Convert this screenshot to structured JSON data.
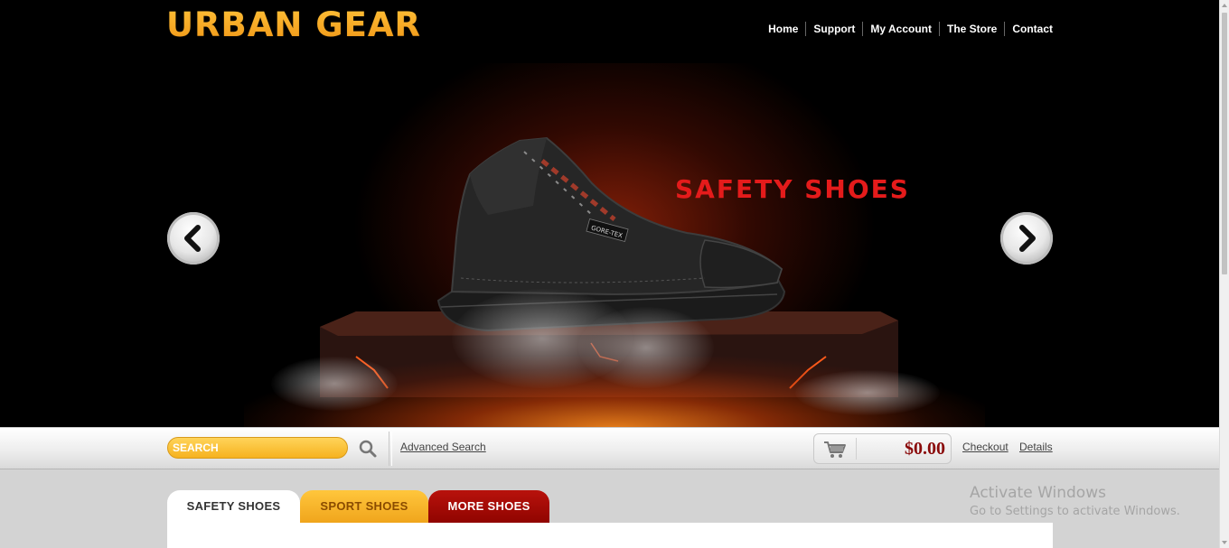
{
  "brand": {
    "logo_text": "URBAN GEAR"
  },
  "nav": {
    "items": [
      "Home",
      "Support",
      "My Account",
      "The Store",
      "Contact"
    ]
  },
  "hero": {
    "title": "SAFETY SHOES",
    "shoe_label": "GORE-TEX",
    "prev_icon": "chevron-left-icon",
    "next_icon": "chevron-right-icon"
  },
  "toolbar": {
    "search_placeholder": "SEARCH",
    "search_icon": "search-icon",
    "advanced_search": "Advanced Search",
    "cart_icon": "cart-icon",
    "cart_total": "$0.00",
    "checkout": "Checkout",
    "details": "Details"
  },
  "tabs": [
    "SAFETY SHOES",
    "SPORT SHOES",
    "MORE SHOES"
  ],
  "watermark": {
    "title": "Activate Windows",
    "subtitle": "Go to Settings to activate Windows."
  },
  "colors": {
    "accent": "#f6b21f",
    "hero_title": "#e41b1b",
    "cart_total": "#8a0a0a",
    "tab_more": "#a00a04"
  }
}
